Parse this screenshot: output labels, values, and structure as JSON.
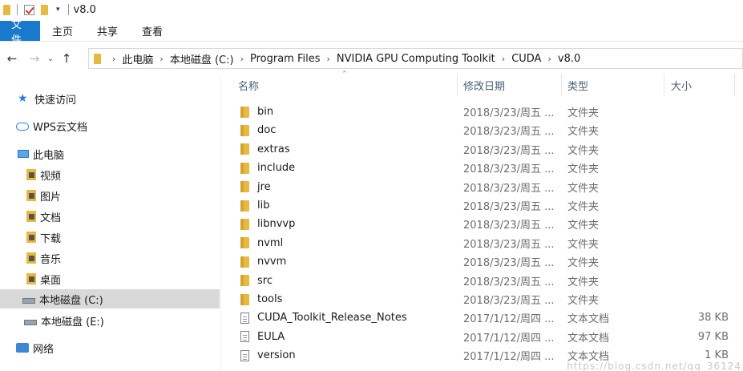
{
  "window": {
    "title": "v8.0"
  },
  "ribbon": {
    "tabs": [
      "文件",
      "主页",
      "共享",
      "查看"
    ]
  },
  "address": {
    "crumbs": [
      "此电脑",
      "本地磁盘 (C:)",
      "Program Files",
      "NVIDIA GPU Computing Toolkit",
      "CUDA",
      "v8.0"
    ]
  },
  "sidebar": {
    "quick_access": "快速访问",
    "wps": "WPS云文档",
    "this_pc": "此电脑",
    "items": [
      "视频",
      "图片",
      "文档",
      "下载",
      "音乐",
      "桌面"
    ],
    "drive_c": "本地磁盘 (C:)",
    "drive_e": "本地磁盘 (E:)",
    "network": "网络"
  },
  "columns": {
    "name": "名称",
    "date": "修改日期",
    "type": "类型",
    "size": "大小"
  },
  "files": [
    {
      "name": "bin",
      "date": "2018/3/23/周五 ...",
      "type": "文件夹",
      "size": "",
      "kind": "folder"
    },
    {
      "name": "doc",
      "date": "2018/3/23/周五 ...",
      "type": "文件夹",
      "size": "",
      "kind": "folder"
    },
    {
      "name": "extras",
      "date": "2018/3/23/周五 ...",
      "type": "文件夹",
      "size": "",
      "kind": "folder"
    },
    {
      "name": "include",
      "date": "2018/3/23/周五 ...",
      "type": "文件夹",
      "size": "",
      "kind": "folder"
    },
    {
      "name": "jre",
      "date": "2018/3/23/周五 ...",
      "type": "文件夹",
      "size": "",
      "kind": "folder"
    },
    {
      "name": "lib",
      "date": "2018/3/23/周五 ...",
      "type": "文件夹",
      "size": "",
      "kind": "folder"
    },
    {
      "name": "libnvvp",
      "date": "2018/3/23/周五 ...",
      "type": "文件夹",
      "size": "",
      "kind": "folder"
    },
    {
      "name": "nvml",
      "date": "2018/3/23/周五 ...",
      "type": "文件夹",
      "size": "",
      "kind": "folder"
    },
    {
      "name": "nvvm",
      "date": "2018/3/23/周五 ...",
      "type": "文件夹",
      "size": "",
      "kind": "folder"
    },
    {
      "name": "src",
      "date": "2018/3/23/周五 ...",
      "type": "文件夹",
      "size": "",
      "kind": "folder"
    },
    {
      "name": "tools",
      "date": "2018/3/23/周五 ...",
      "type": "文件夹",
      "size": "",
      "kind": "folder"
    },
    {
      "name": "CUDA_Toolkit_Release_Notes",
      "date": "2017/1/12/周四 ...",
      "type": "文本文档",
      "size": "38 KB",
      "kind": "file"
    },
    {
      "name": "EULA",
      "date": "2017/1/12/周四 ...",
      "type": "文本文档",
      "size": "97 KB",
      "kind": "file"
    },
    {
      "name": "version",
      "date": "2017/1/12/周四 ...",
      "type": "文本文档",
      "size": "1 KB",
      "kind": "file"
    }
  ],
  "watermark": "https://blog.csdn.net/qq_36124"
}
